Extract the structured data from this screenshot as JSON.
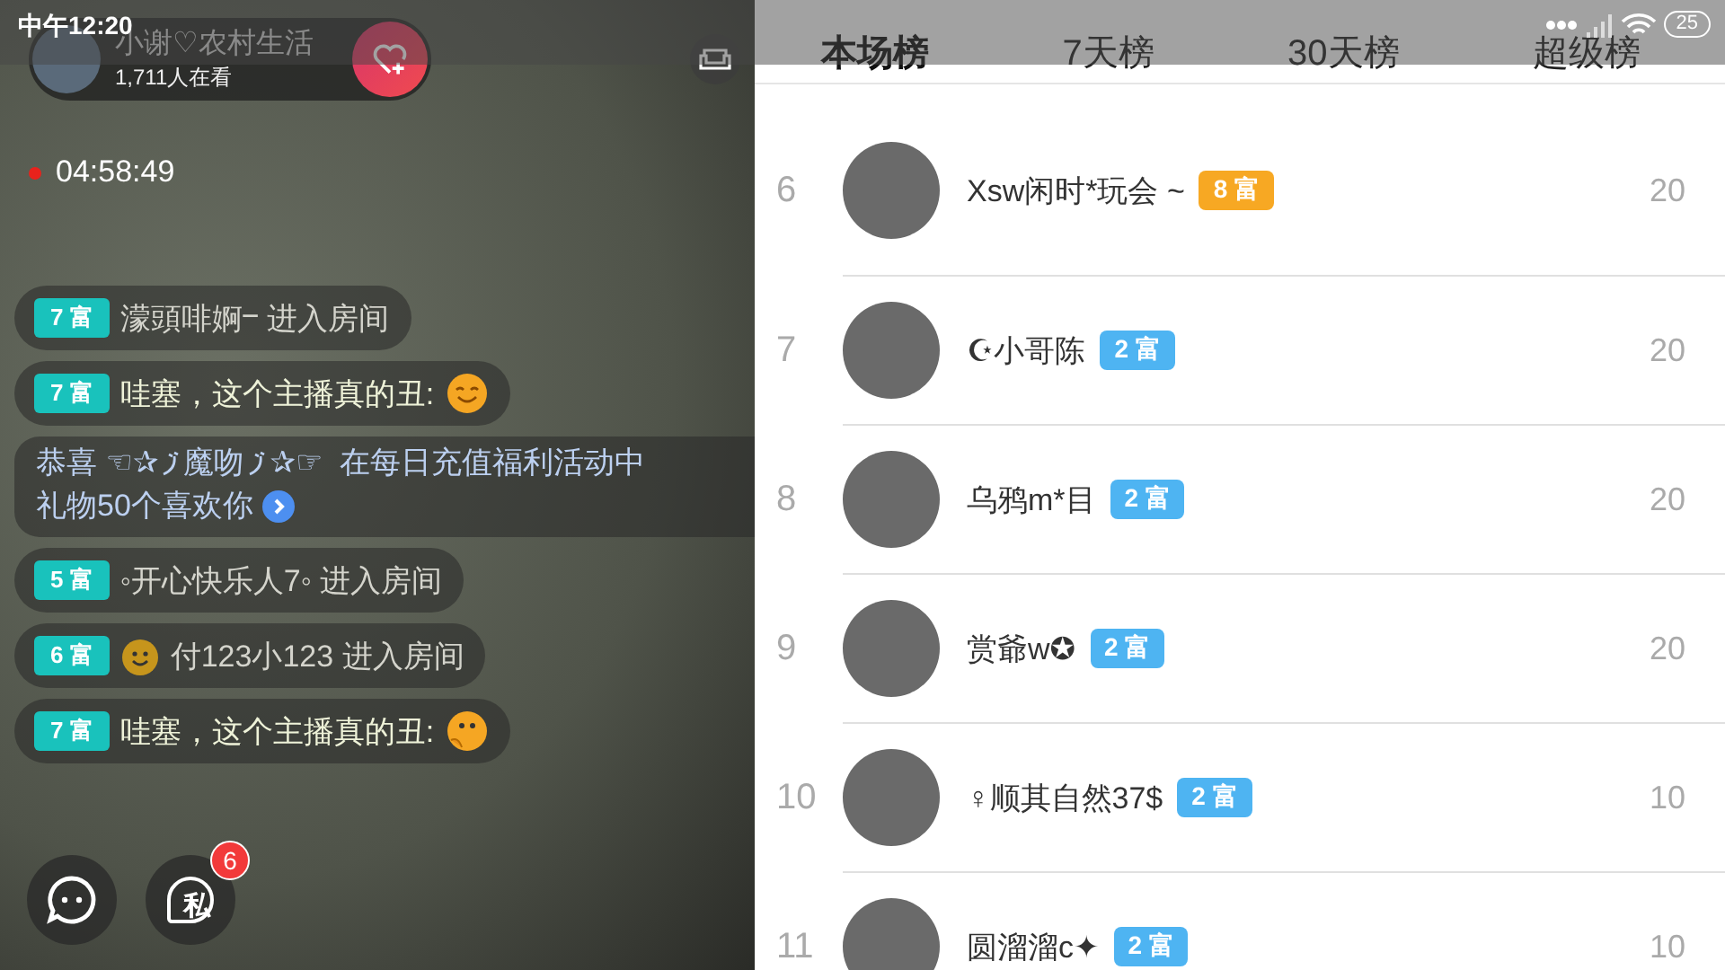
{
  "status_bar": {
    "time": "中午12:20",
    "battery": "25"
  },
  "host": {
    "name": "小谢♡农村生活",
    "viewers": "1,711人在看"
  },
  "live_timer": "04:58:49",
  "messages": [
    {
      "kind": "enter",
      "badge": "7 富",
      "text": "濛頭啡婀ⲻ 进入房间"
    },
    {
      "kind": "chat",
      "badge": "7 富",
      "text": "哇塞，这个主播真的丑:",
      "emoji": {
        "kind": "smile"
      }
    },
    {
      "kind": "system",
      "first_line": [
        "恭喜 ☜✰",
        "魔吻",
        "✰☞  在每日充值福利活动中"
      ],
      "second_line": "礼物50个喜欢你"
    },
    {
      "kind": "enter",
      "badge": "5 富",
      "text": "◦开心快乐人7◦  进入房间"
    },
    {
      "kind": "enter",
      "badge": "6 富",
      "text": "付123小123 进入房间",
      "lead_emoji": {
        "kind": "grin"
      }
    },
    {
      "kind": "chat",
      "badge": "7 富",
      "text": "哇塞，这个主播真的丑:",
      "emoji": {
        "kind": "think"
      }
    }
  ],
  "private_badge": "6",
  "private_label": "私",
  "tabs": [
    {
      "label": "本场榜",
      "selected": true
    },
    {
      "label": "7天榜",
      "selected": false
    },
    {
      "label": "30天榜",
      "selected": false
    },
    {
      "label": "超级榜",
      "selected": false
    }
  ],
  "ranking": [
    {
      "rank": "6",
      "name": "Xsw闲时*玩会 ~",
      "badge": "8 富",
      "color": "#f7a823",
      "score": "20"
    },
    {
      "rank": "7",
      "name": "☪小哥陈",
      "badge": "2 富",
      "color": "#4eb4f2",
      "score": "20"
    },
    {
      "rank": "8",
      "name": "乌鸦m*目",
      "badge": "2 富",
      "color": "#4eb4f2",
      "score": "20"
    },
    {
      "rank": "9",
      "name": "赏爺w✪",
      "badge": "2 富",
      "color": "#4eb4f2",
      "score": "20"
    },
    {
      "rank": "10",
      "name": "♀顺其自然37$",
      "badge": "2 富",
      "color": "#4eb4f2",
      "score": "10"
    },
    {
      "rank": "11",
      "name": "圆溜溜c✦",
      "badge": "2 富",
      "color": "#4eb4f2",
      "score": "10"
    }
  ]
}
